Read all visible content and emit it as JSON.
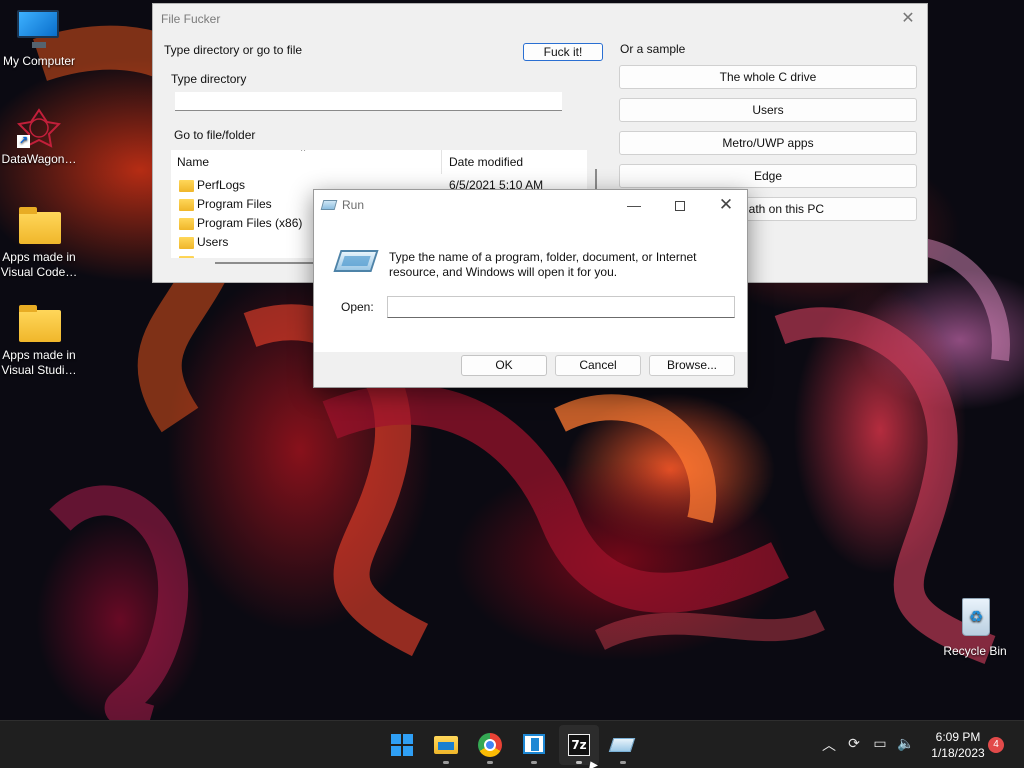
{
  "desktop": {
    "icons": [
      {
        "label": "My Computer",
        "icon": "monitor-icon"
      },
      {
        "label": "DataWagon…",
        "icon": "shortcut-icon"
      },
      {
        "label": "Apps made in\nVisual Code…",
        "icon": "folder-icon"
      },
      {
        "label": "Apps made in\nVisual Studi…",
        "icon": "folder-icon"
      },
      {
        "label": "Recycle Bin",
        "icon": "recycle-bin-icon"
      }
    ]
  },
  "file_window": {
    "title": "File Fucker",
    "go_label": "Type directory or go to file",
    "go_button": "Fuck it!",
    "type_directory_label": "Type directory",
    "directory_value": "",
    "goto_label": "Go to file/folder",
    "columns": {
      "name": "Name",
      "date": "Date modified"
    },
    "files": [
      {
        "name": "PerfLogs",
        "date": "6/5/2021 5:10 AM"
      },
      {
        "name": "Program Files",
        "date": ""
      },
      {
        "name": "Program Files (x86)",
        "date": ""
      },
      {
        "name": "Users",
        "date": ""
      }
    ],
    "sample_label": "Or a sample",
    "samples": [
      "The whole C drive",
      "Users",
      "Metro/UWP apps",
      "Edge",
      "o do math on this PC"
    ]
  },
  "run_dialog": {
    "title": "Run",
    "description": "Type the name of a program, folder, document, or Internet resource, and Windows will open it for you.",
    "open_label": "Open:",
    "open_value": "",
    "ok": "OK",
    "cancel": "Cancel",
    "browse": "Browse..."
  },
  "taskbar": {
    "apps": [
      "start",
      "file-explorer",
      "chrome",
      "app",
      "7-zip",
      "run"
    ],
    "clock_time": "6:09 PM",
    "clock_date": "1/18/2023",
    "notification_count": "4",
    "accent": "#2f9ff5"
  }
}
